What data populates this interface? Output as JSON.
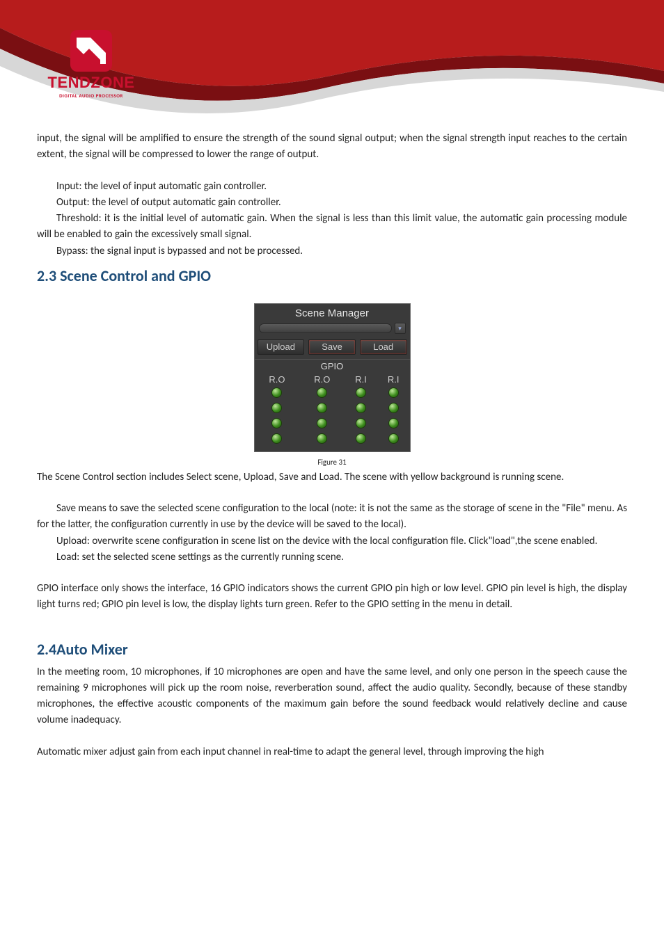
{
  "logo": {
    "word": "TENDZONE",
    "tag": "DIGITAL AUDIO PROCESSOR"
  },
  "intro_p1": "input, the signal will be amplified to ensure the strength of the sound signal output; when the signal strength input reaches to the certain extent, the signal will be compressed to lower the range of output.",
  "defs": {
    "input": "Input: the level of input automatic gain controller.",
    "output": "Output: the level of output automatic gain controller.",
    "threshold": "Threshold: it is the initial level of automatic gain. When the signal is less than this limit value, the automatic gain processing module will be enabled to gain the excessively small signal.",
    "bypass": "Bypass: the signal input is bypassed and not be processed."
  },
  "sec23_title": "2.3 Scene Control and GPIO",
  "scene_mgr": {
    "title": "Scene Manager",
    "upload": "Upload",
    "save": "Save",
    "load": "Load",
    "gpio": "GPIO",
    "cols": [
      "R.O",
      "R.O",
      "R.I",
      "R.I"
    ]
  },
  "fig31": "Figure 31",
  "sec23_p1": "The Scene Control section includes Select scene, Upload, Save and Load. The scene with yellow background is running scene.",
  "sec23_save": "Save means to save the selected scene configuration to the local (note: it is not the same as the storage of scene in the \"File\" menu. As for the latter, the configuration currently in use by the device will be saved to the local).",
  "sec23_upload": "Upload: overwrite scene configuration in scene list on the device with the local configuration file. Click\"load\",the scene enabled.",
  "sec23_load": "Load: set the selected scene settings as the currently running scene.",
  "sec23_gpio": "GPIO interface only shows the interface, 16 GPIO indicators shows the current GPIO pin high or low level. GPIO pin level is high, the display light turns red; GPIO pin level is low, the display lights turn green. Refer to the GPIO setting in the menu in detail.",
  "sec24_title": "2.4Auto Mixer",
  "sec24_p1": "In the meeting room, 10 microphones, if 10 microphones are open and have the same level, and only one person in the speech cause the remaining 9 microphones will pick up the room noise, reverberation sound, affect the audio quality. Secondly, because of these standby microphones, the effective acoustic components of the maximum gain before the sound feedback would relatively decline and cause volume inadequacy.",
  "sec24_p2": "Automatic mixer adjust gain from each input channel in real-time to adapt the general level, through improving the high"
}
